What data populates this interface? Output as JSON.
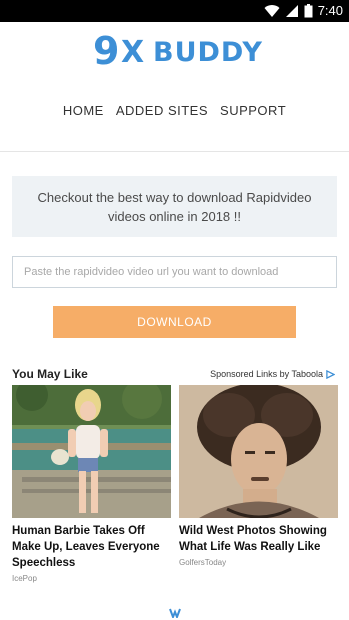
{
  "status_bar": {
    "time": "7:40"
  },
  "logo": {
    "nine": "9",
    "x": "X",
    "buddy": "BUDDY"
  },
  "nav": [
    {
      "label": "HOME"
    },
    {
      "label": "ADDED SITES"
    },
    {
      "label": "SUPPORT"
    }
  ],
  "promo": {
    "text": "Checkout the best way to download Rapidvideo videos online in 2018 !!"
  },
  "url_input": {
    "placeholder": "Paste the rapidvideo video url you want to download",
    "value": ""
  },
  "download_button": {
    "label": "DOWNLOAD"
  },
  "recommendations": {
    "heading": "You May Like",
    "sponsored": "Sponsored Links by Taboola",
    "cards": [
      {
        "title": "Human Barbie Takes Off Make Up, Leaves Everyone Speechless",
        "source": "IcePop"
      },
      {
        "title": "Wild West Photos Showing What Life Was Really Like",
        "source": "GolfersToday"
      }
    ]
  },
  "colors": {
    "brand": "#3d8fd6",
    "button": "#f6ad67",
    "promo_bg": "#eef2f5"
  }
}
